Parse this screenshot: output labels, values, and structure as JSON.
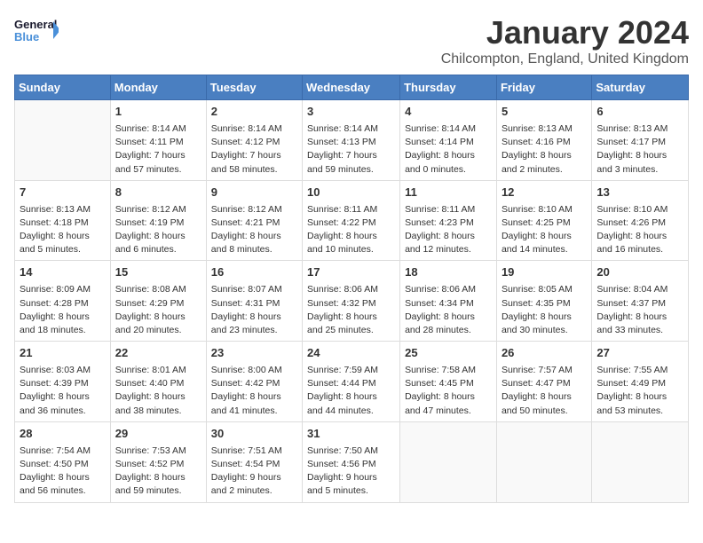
{
  "logo": {
    "line1": "General",
    "line2": "Blue"
  },
  "title": "January 2024",
  "subtitle": "Chilcompton, England, United Kingdom",
  "weekdays": [
    "Sunday",
    "Monday",
    "Tuesday",
    "Wednesday",
    "Thursday",
    "Friday",
    "Saturday"
  ],
  "weeks": [
    [
      {
        "day": "",
        "info": ""
      },
      {
        "day": "1",
        "info": "Sunrise: 8:14 AM\nSunset: 4:11 PM\nDaylight: 7 hours\nand 57 minutes."
      },
      {
        "day": "2",
        "info": "Sunrise: 8:14 AM\nSunset: 4:12 PM\nDaylight: 7 hours\nand 58 minutes."
      },
      {
        "day": "3",
        "info": "Sunrise: 8:14 AM\nSunset: 4:13 PM\nDaylight: 7 hours\nand 59 minutes."
      },
      {
        "day": "4",
        "info": "Sunrise: 8:14 AM\nSunset: 4:14 PM\nDaylight: 8 hours\nand 0 minutes."
      },
      {
        "day": "5",
        "info": "Sunrise: 8:13 AM\nSunset: 4:16 PM\nDaylight: 8 hours\nand 2 minutes."
      },
      {
        "day": "6",
        "info": "Sunrise: 8:13 AM\nSunset: 4:17 PM\nDaylight: 8 hours\nand 3 minutes."
      }
    ],
    [
      {
        "day": "7",
        "info": "Sunrise: 8:13 AM\nSunset: 4:18 PM\nDaylight: 8 hours\nand 5 minutes."
      },
      {
        "day": "8",
        "info": "Sunrise: 8:12 AM\nSunset: 4:19 PM\nDaylight: 8 hours\nand 6 minutes."
      },
      {
        "day": "9",
        "info": "Sunrise: 8:12 AM\nSunset: 4:21 PM\nDaylight: 8 hours\nand 8 minutes."
      },
      {
        "day": "10",
        "info": "Sunrise: 8:11 AM\nSunset: 4:22 PM\nDaylight: 8 hours\nand 10 minutes."
      },
      {
        "day": "11",
        "info": "Sunrise: 8:11 AM\nSunset: 4:23 PM\nDaylight: 8 hours\nand 12 minutes."
      },
      {
        "day": "12",
        "info": "Sunrise: 8:10 AM\nSunset: 4:25 PM\nDaylight: 8 hours\nand 14 minutes."
      },
      {
        "day": "13",
        "info": "Sunrise: 8:10 AM\nSunset: 4:26 PM\nDaylight: 8 hours\nand 16 minutes."
      }
    ],
    [
      {
        "day": "14",
        "info": "Sunrise: 8:09 AM\nSunset: 4:28 PM\nDaylight: 8 hours\nand 18 minutes."
      },
      {
        "day": "15",
        "info": "Sunrise: 8:08 AM\nSunset: 4:29 PM\nDaylight: 8 hours\nand 20 minutes."
      },
      {
        "day": "16",
        "info": "Sunrise: 8:07 AM\nSunset: 4:31 PM\nDaylight: 8 hours\nand 23 minutes."
      },
      {
        "day": "17",
        "info": "Sunrise: 8:06 AM\nSunset: 4:32 PM\nDaylight: 8 hours\nand 25 minutes."
      },
      {
        "day": "18",
        "info": "Sunrise: 8:06 AM\nSunset: 4:34 PM\nDaylight: 8 hours\nand 28 minutes."
      },
      {
        "day": "19",
        "info": "Sunrise: 8:05 AM\nSunset: 4:35 PM\nDaylight: 8 hours\nand 30 minutes."
      },
      {
        "day": "20",
        "info": "Sunrise: 8:04 AM\nSunset: 4:37 PM\nDaylight: 8 hours\nand 33 minutes."
      }
    ],
    [
      {
        "day": "21",
        "info": "Sunrise: 8:03 AM\nSunset: 4:39 PM\nDaylight: 8 hours\nand 36 minutes."
      },
      {
        "day": "22",
        "info": "Sunrise: 8:01 AM\nSunset: 4:40 PM\nDaylight: 8 hours\nand 38 minutes."
      },
      {
        "day": "23",
        "info": "Sunrise: 8:00 AM\nSunset: 4:42 PM\nDaylight: 8 hours\nand 41 minutes."
      },
      {
        "day": "24",
        "info": "Sunrise: 7:59 AM\nSunset: 4:44 PM\nDaylight: 8 hours\nand 44 minutes."
      },
      {
        "day": "25",
        "info": "Sunrise: 7:58 AM\nSunset: 4:45 PM\nDaylight: 8 hours\nand 47 minutes."
      },
      {
        "day": "26",
        "info": "Sunrise: 7:57 AM\nSunset: 4:47 PM\nDaylight: 8 hours\nand 50 minutes."
      },
      {
        "day": "27",
        "info": "Sunrise: 7:55 AM\nSunset: 4:49 PM\nDaylight: 8 hours\nand 53 minutes."
      }
    ],
    [
      {
        "day": "28",
        "info": "Sunrise: 7:54 AM\nSunset: 4:50 PM\nDaylight: 8 hours\nand 56 minutes."
      },
      {
        "day": "29",
        "info": "Sunrise: 7:53 AM\nSunset: 4:52 PM\nDaylight: 8 hours\nand 59 minutes."
      },
      {
        "day": "30",
        "info": "Sunrise: 7:51 AM\nSunset: 4:54 PM\nDaylight: 9 hours\nand 2 minutes."
      },
      {
        "day": "31",
        "info": "Sunrise: 7:50 AM\nSunset: 4:56 PM\nDaylight: 9 hours\nand 5 minutes."
      },
      {
        "day": "",
        "info": ""
      },
      {
        "day": "",
        "info": ""
      },
      {
        "day": "",
        "info": ""
      }
    ]
  ]
}
